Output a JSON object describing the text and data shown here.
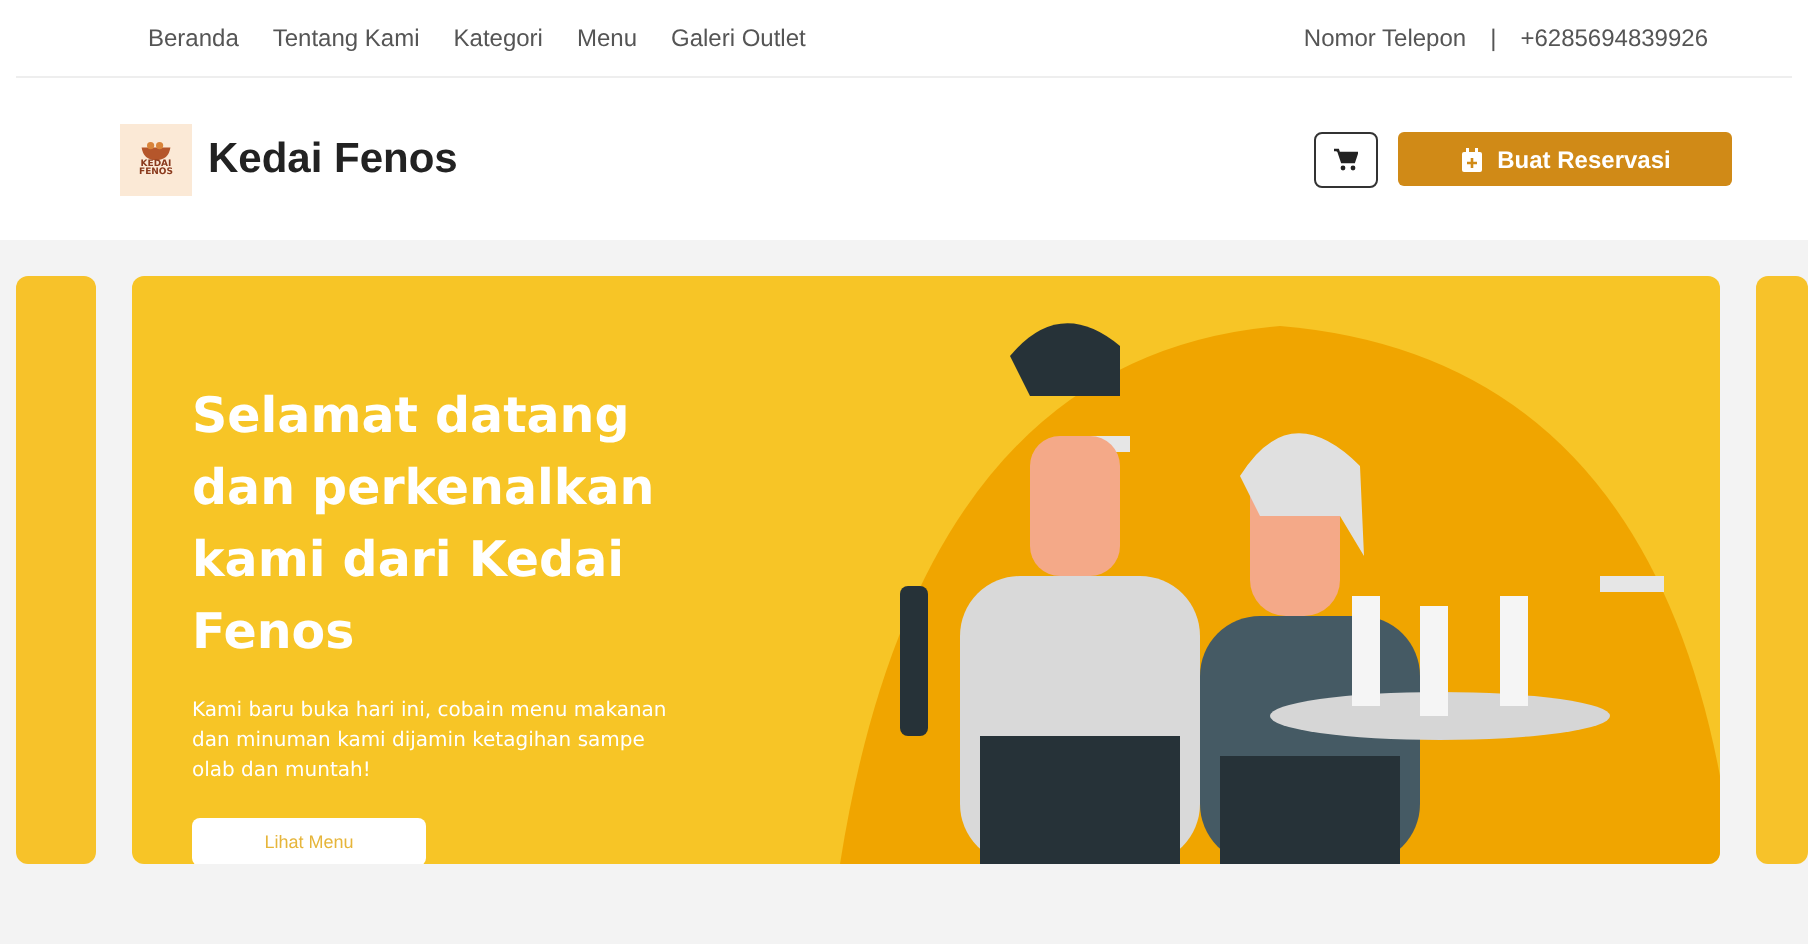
{
  "topbar": {
    "nav": [
      {
        "label": "Beranda"
      },
      {
        "label": "Tentang Kami"
      },
      {
        "label": "Kategori"
      },
      {
        "label": "Menu"
      },
      {
        "label": "Galeri Outlet"
      }
    ],
    "phone_label": "Nomor Telepon",
    "separator": "|",
    "phone": "+6285694839926"
  },
  "header": {
    "logo_text": [
      "KEDAI",
      "FENOS"
    ],
    "brand": "Kedai Fenos",
    "reservation_button": "Buat Reservasi"
  },
  "hero": {
    "title": "Selamat datang dan perkenalkan kami dari Kedai Fenos",
    "text": "Kami baru buka hari ini, cobain menu makanan dan minuman kami dijamin ketagihan sampe olab dan muntah!",
    "button": "Lihat Menu"
  }
}
